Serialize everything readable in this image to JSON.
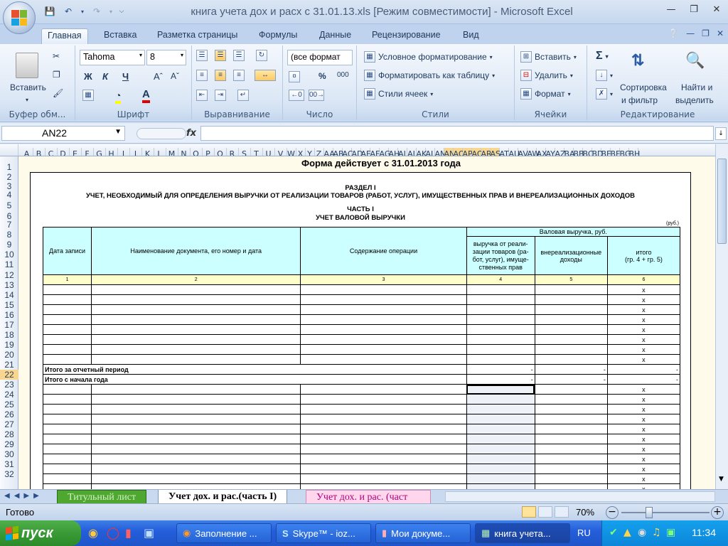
{
  "window": {
    "title": "книга учета дох и расх с 31.01.13.xls  [Режим совместимости] - Microsoft Excel"
  },
  "ribbon_tabs": [
    "Главная",
    "Вставка",
    "Разметка страницы",
    "Формулы",
    "Данные",
    "Рецензирование",
    "Вид"
  ],
  "groups": {
    "clipboard": {
      "label": "Буфер обм...",
      "paste": "Вставить"
    },
    "font": {
      "label": "Шрифт",
      "name": "Tahoma",
      "size": "8",
      "bold": "Ж",
      "italic": "К",
      "underline": "Ч"
    },
    "alignment": {
      "label": "Выравнивание"
    },
    "number": {
      "label": "Число",
      "format": "(все формат",
      "percent": "%",
      "thousands": "000"
    },
    "styles": {
      "label": "Стили",
      "conditional": "Условное форматирование",
      "as_table": "Форматировать как таблицу",
      "cell_styles": "Стили ячеек"
    },
    "cells": {
      "label": "Ячейки",
      "insert": "Вставить",
      "delete": "Удалить",
      "format": "Формат"
    },
    "editing": {
      "label": "Редактирование",
      "sort_l1": "Сортировка",
      "sort_l2": "и фильтр",
      "find_l1": "Найти и",
      "find_l2": "выделить"
    }
  },
  "formula_bar": {
    "name_box": "AN22",
    "fx": "fx",
    "value": ""
  },
  "columns": [
    "A",
    "B",
    "C",
    "D",
    "E",
    "F",
    "G",
    "H",
    "I",
    "J",
    "K",
    "L",
    "M",
    "N",
    "O",
    "P",
    "Q",
    "R",
    "S",
    "T",
    "U",
    "V",
    "W",
    "X",
    "Y",
    "Z",
    "AA",
    "AB",
    "AC",
    "AD",
    "AE",
    "AF",
    "AG",
    "AH",
    "AI",
    "AJ",
    "AK",
    "AL",
    "AM",
    "AN",
    "AO",
    "AP",
    "AQ",
    "AR",
    "AS",
    "AT",
    "AU",
    "AV",
    "AW",
    "AX",
    "AY",
    "AZ",
    "BA",
    "BB",
    "BC",
    "BD",
    "BE",
    "BF",
    "BG",
    "BH"
  ],
  "rows": [
    "1",
    "2",
    "3",
    "4",
    "5",
    "6",
    "7",
    "8",
    "9",
    "10",
    "11",
    "12",
    "13",
    "14",
    "15",
    "16",
    "17",
    "18",
    "19",
    "20",
    "21",
    "22",
    "23",
    "24",
    "25",
    "26",
    "27",
    "28",
    "29",
    "30",
    "31",
    "32"
  ],
  "document": {
    "form_note": "Форма действует с 31.01.2013 года",
    "section": "РАЗДЕЛ I",
    "section_title": "УЧЕТ, НЕОБХОДИМЫЙ ДЛЯ ОПРЕДЕЛЕНИЯ ВЫРУЧКИ ОТ РЕАЛИЗАЦИИ ТОВАРОВ (РАБОТ, УСЛУГ), ИМУЩЕСТВЕННЫХ ПРАВ И ВНЕРЕАЛИЗАЦИОННЫХ ДОХОДОВ",
    "part": "ЧАСТЬ I",
    "part_title": "УЧЕТ ВАЛОВОЙ ВЫРУЧКИ",
    "unit": "(руб.)",
    "headers": {
      "date": "Дата записи",
      "doc": "Наименование документа, его номер и дата",
      "content": "Содержание операции",
      "gross": "Валовая выручка, руб.",
      "sales_l1": "выручка от реали-",
      "sales_l2": "зации товаров (ра-",
      "sales_l3": "бот, услуг), имуще-",
      "sales_l4": "ственных прав",
      "nonop_l1": "внереализационные",
      "nonop_l2": "доходы",
      "total_l1": "итого",
      "total_l2": "(гр. 4 + гр. 5)"
    },
    "col_numbers": [
      "1",
      "2",
      "3",
      "4",
      "5",
      "6"
    ],
    "x_mark": "x",
    "dash": "-",
    "period_total": "Итого за отчетный период",
    "ytd_total": "Итого с начала года"
  },
  "sheet_tabs": [
    "Титульный лист",
    "Учет дох. и рас.(часть I)",
    "Учет дох. и рас. (част"
  ],
  "status": {
    "ready": "Готово",
    "zoom": "70%"
  },
  "taskbar": {
    "start": "пуск",
    "tasks": [
      "Заполнение ...",
      "Skype™ - ioz...",
      "Мои докуме...",
      "книга учета..."
    ],
    "lang": "RU",
    "clock": "11:34"
  }
}
